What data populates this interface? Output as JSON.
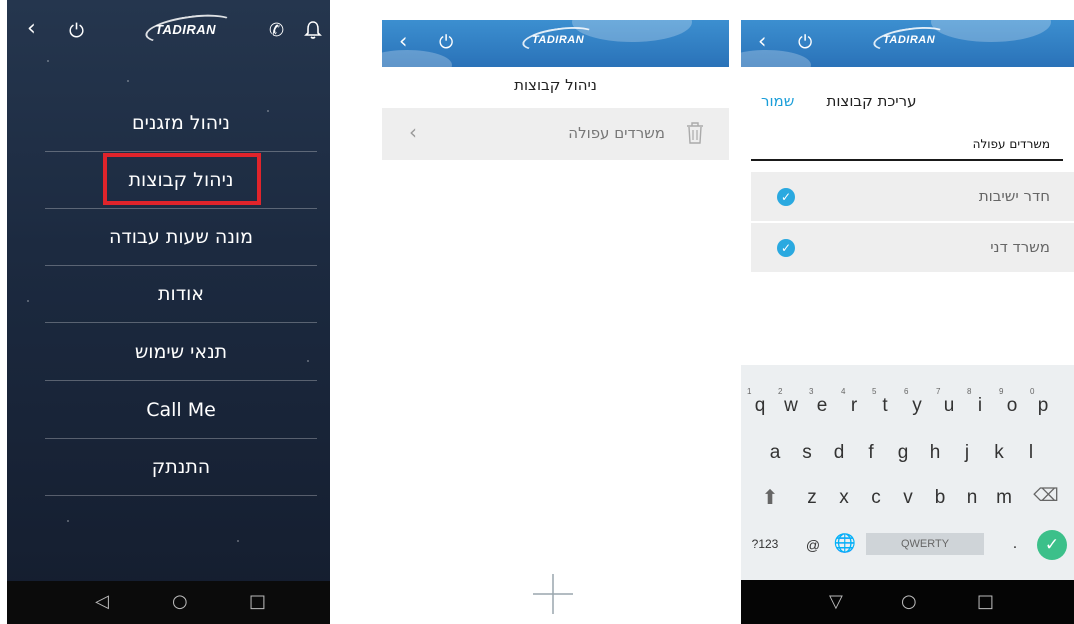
{
  "brand": "TADIRAN",
  "colors": {
    "menu_bg": "#1c2a40",
    "highlight": "#e0242b",
    "header_blue": "#2a72b8",
    "accent": "#1a9ed9",
    "check_blue": "#2aa9e0",
    "enter_green": "#3cc08a"
  },
  "menu_screen": {
    "icons": [
      "back-icon",
      "power-icon",
      "phone-icon",
      "bell-icon"
    ],
    "items": [
      {
        "label": "ניהול מזגנים"
      },
      {
        "label": "ניהול קבוצות",
        "highlighted": true
      },
      {
        "label": "מונה שעות עבודה"
      },
      {
        "label": "אודות"
      },
      {
        "label": "תנאי שימוש"
      },
      {
        "label": "Call Me"
      },
      {
        "label": "התנתק"
      }
    ]
  },
  "groups_screen": {
    "title": "ניהול קבוצות",
    "groups": [
      {
        "name": "משרדים עפולה"
      }
    ]
  },
  "edit_screen": {
    "title": "עריכת קבוצות",
    "save_label": "שמור",
    "group_name_value": "משרדים עפולה",
    "members": [
      {
        "name": "חדר ישיבות",
        "checked": true
      },
      {
        "name": "משרד דני",
        "checked": true
      }
    ]
  },
  "keyboard": {
    "row1": [
      "q",
      "w",
      "e",
      "r",
      "t",
      "y",
      "u",
      "i",
      "o",
      "p"
    ],
    "row1_hints": [
      "1",
      "2",
      "3",
      "4",
      "5",
      "6",
      "7",
      "8",
      "9",
      "0"
    ],
    "row2": [
      "a",
      "s",
      "d",
      "f",
      "g",
      "h",
      "j",
      "k",
      "l"
    ],
    "row3": [
      "z",
      "x",
      "c",
      "v",
      "b",
      "n",
      "m"
    ],
    "symbols_label": "?123",
    "at_label": "@",
    "space_label": "QWERTY",
    "period_label": "."
  }
}
